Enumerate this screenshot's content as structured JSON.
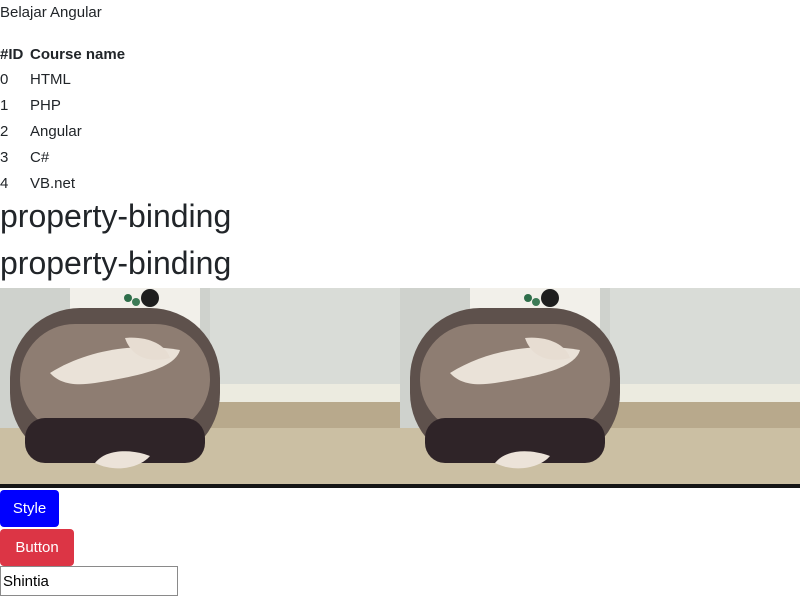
{
  "app": {
    "title": "Belajar Angular"
  },
  "table": {
    "headers": [
      "#ID",
      "Course name"
    ],
    "rows": [
      {
        "id": "0",
        "name": "HTML"
      },
      {
        "id": "1",
        "name": "PHP"
      },
      {
        "id": "2",
        "name": "Angular"
      },
      {
        "id": "3",
        "name": "C#"
      },
      {
        "id": "4",
        "name": "VB.net"
      }
    ]
  },
  "headings": [
    "property-binding",
    "property-binding"
  ],
  "images": [
    {
      "icon": "photo-person-sitting"
    },
    {
      "icon": "photo-person-sitting"
    }
  ],
  "buttons": {
    "style_label": "Style",
    "style_color": "#0000ff",
    "danger_label": "Button",
    "danger_color": "#dc3545"
  },
  "input": {
    "value": "Shintia"
  }
}
